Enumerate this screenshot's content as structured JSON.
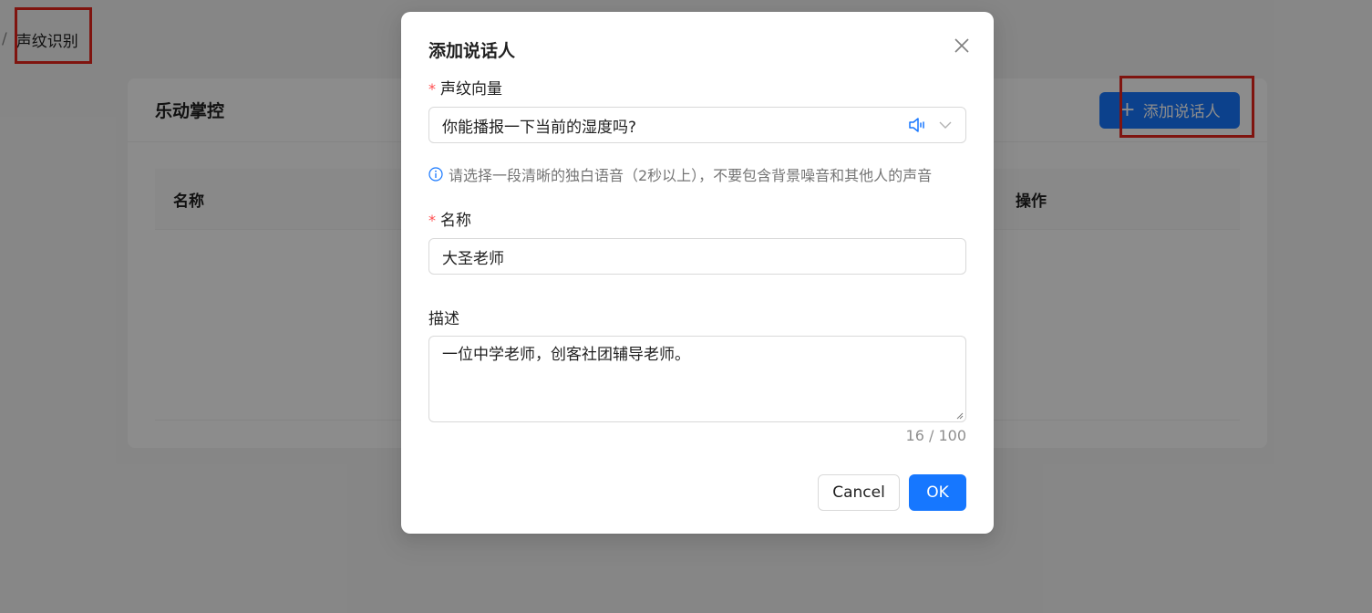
{
  "breadcrumb": {
    "separator": "/",
    "current": "声纹识别"
  },
  "card": {
    "title": "乐动掌控",
    "add_button": {
      "icon": "plus-icon",
      "label": "添加说话人"
    },
    "table": {
      "columns": [
        "名称",
        "操作"
      ]
    }
  },
  "modal": {
    "title": "添加说话人",
    "close_icon": "close-icon",
    "voiceprint": {
      "label": "声纹向量",
      "required_mark": "*",
      "value": "你能播报一下当前的湿度吗?",
      "hint": "请选择一段清晰的独白语音（2秒以上），不要包含背景噪音和其他人的声音"
    },
    "name": {
      "label": "名称",
      "required_mark": "*",
      "value": "大圣老师"
    },
    "description": {
      "label": "描述",
      "value": "一位中学老师，创客社团辅导老师。",
      "counter": "16 / 100"
    },
    "buttons": {
      "cancel": "Cancel",
      "ok": "OK"
    }
  },
  "colors": {
    "primary": "#1677ff",
    "required": "#ff4d4f",
    "annotation": "#e8261c"
  }
}
